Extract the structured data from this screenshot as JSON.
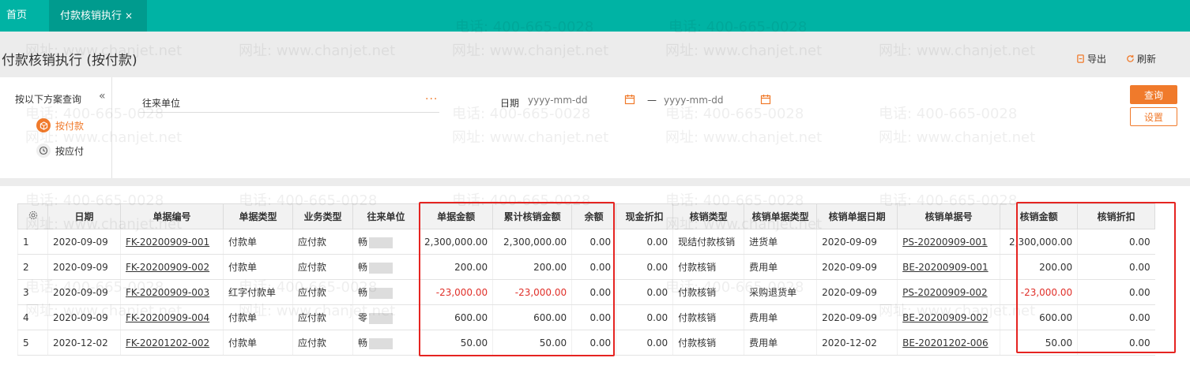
{
  "tabs": {
    "home": "首页",
    "active": "付款核销执行",
    "close": "×"
  },
  "watermark": {
    "phone": "电话: 400-665-0028",
    "site": "网址: www.chanjet.net"
  },
  "page": {
    "title": "付款核销执行 (按付款)",
    "export_label": "导出",
    "refresh_label": "刷新"
  },
  "query": {
    "scheme_title": "按以下方案查询",
    "collapse_glyph": "«",
    "schemes": [
      "按付款",
      "按应付"
    ],
    "unit_label": "往来单位",
    "unit_dots": "···",
    "date_label": "日期",
    "date_placeholder": "yyyy-mm-dd",
    "date_sep": "—",
    "query_label": "查询",
    "settings_label": "设置"
  },
  "table": {
    "headers": [
      "日期",
      "单据编号",
      "单据类型",
      "业务类型",
      "往来单位",
      "单据金额",
      "累计核销金额",
      "余额",
      "现金折扣",
      "核销类型",
      "核销单据类型",
      "核销单据日期",
      "核销单据号",
      "核销金额",
      "核销折扣"
    ],
    "rows": [
      [
        "1",
        "2020-09-09",
        "FK-20200909-001",
        "付款单",
        "应付款",
        "畅",
        "2,300,000.00",
        "2,300,000.00",
        "0.00",
        "0.00",
        "现结付款核销",
        "进货单",
        "2020-09-09",
        "PS-20200909-001",
        "2,300,000.00",
        "0.00"
      ],
      [
        "2",
        "2020-09-09",
        "FK-20200909-002",
        "付款单",
        "应付款",
        "畅",
        "200.00",
        "200.00",
        "0.00",
        "0.00",
        "付款核销",
        "费用单",
        "2020-09-09",
        "BE-20200909-001",
        "200.00",
        "0.00"
      ],
      [
        "3",
        "2020-09-09",
        "FK-20200909-003",
        "红字付款单",
        "应付款",
        "畅",
        "-23,000.00",
        "-23,000.00",
        "0.00",
        "0.00",
        "付款核销",
        "采购退货单",
        "2020-09-09",
        "PS-20200909-002",
        "-23,000.00",
        "0.00"
      ],
      [
        "4",
        "2020-09-09",
        "FK-20200909-004",
        "付款单",
        "应付款",
        "零",
        "600.00",
        "600.00",
        "0.00",
        "0.00",
        "付款核销",
        "费用单",
        "2020-09-09",
        "BE-20200909-002",
        "600.00",
        "0.00"
      ],
      [
        "5",
        "2020-12-02",
        "FK-20201202-002",
        "付款单",
        "应付款",
        "畅",
        "50.00",
        "50.00",
        "0.00",
        "0.00",
        "付款核销",
        "费用单",
        "2020-12-02",
        "BE-20201202-006",
        "50.00",
        "0.00"
      ]
    ]
  },
  "colors": {
    "teal": "#00b3a4",
    "orange": "#f07a2b",
    "negative": "#e0302a",
    "highlight": "#e52421"
  }
}
